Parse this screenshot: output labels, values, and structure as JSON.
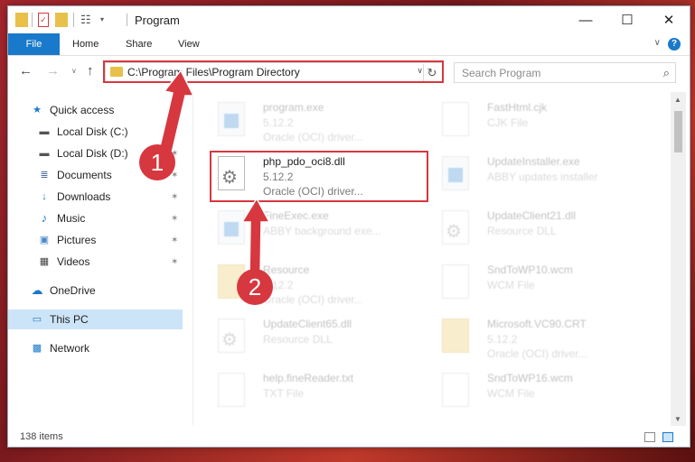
{
  "window": {
    "title": "Program"
  },
  "ribbon": {
    "tabs": [
      "File",
      "Home",
      "Share",
      "View"
    ],
    "help": "?"
  },
  "address": {
    "path": "C:\\Program Files\\Program Directory",
    "refresh_glyph": "↻",
    "dropdown_glyph": "∨"
  },
  "search": {
    "placeholder": "Search Program"
  },
  "nav_buttons": {
    "back": "←",
    "forward": "→",
    "up": "↑",
    "recent": "∨"
  },
  "window_controls": {
    "minimize": "—",
    "maximize": "☐",
    "close": "✕"
  },
  "sidebar": {
    "items": [
      {
        "label": "Quick access",
        "icon": "star-icon",
        "glyph": "★",
        "color": "#1979ca"
      },
      {
        "label": "Local Disk (C:)",
        "icon": "drive-icon",
        "glyph": "▬",
        "color": "#555555",
        "pinned": true
      },
      {
        "label": "Local Disk (D:)",
        "icon": "drive-icon",
        "glyph": "▬",
        "color": "#555555",
        "pinned": true
      },
      {
        "label": "Documents",
        "icon": "documents-icon",
        "glyph": "≣",
        "color": "#4a6fa5",
        "pinned": true
      },
      {
        "label": "Downloads",
        "icon": "download-icon",
        "glyph": "↓",
        "color": "#1979ca",
        "pinned": true
      },
      {
        "label": "Music",
        "icon": "music-icon",
        "glyph": "♪",
        "color": "#1979ca",
        "pinned": true
      },
      {
        "label": "Pictures",
        "icon": "pictures-icon",
        "glyph": "▣",
        "color": "#4a8ac9",
        "pinned": true
      },
      {
        "label": "Videos",
        "icon": "videos-icon",
        "glyph": "▦",
        "color": "#444444",
        "pinned": true
      },
      {
        "label": "OneDrive",
        "icon": "cloud-icon",
        "glyph": "☁",
        "color": "#1979ca"
      },
      {
        "label": "This PC",
        "icon": "computer-icon",
        "glyph": "▭",
        "color": "#1979ca",
        "selected": true
      },
      {
        "label": "Network",
        "icon": "network-icon",
        "glyph": "▩",
        "color": "#1979ca"
      }
    ],
    "pin_glyph": "✶"
  },
  "files": [
    {
      "name": "program.exe",
      "line2": "5.12.2",
      "line3": "Oracle (OCI) driver...",
      "kind": "exe"
    },
    {
      "name": "FastHtml.cjk",
      "line2": "CJK File",
      "line3": "",
      "kind": "doc"
    },
    {
      "name": "php_pdo_oci8.dll",
      "line2": "5.12.2",
      "line3": "Oracle (OCI) driver...",
      "kind": "gear",
      "highlighted": true
    },
    {
      "name": "UpdateInstaller.exe",
      "line2": "ABBY updates installer",
      "line3": "",
      "kind": "exe"
    },
    {
      "name": "FineExec.exe",
      "line2": "ABBY background exe...",
      "line3": "",
      "kind": "exe"
    },
    {
      "name": "UpdateClient21.dll",
      "line2": "Resource DLL",
      "line3": "",
      "kind": "gear"
    },
    {
      "name": "Resource",
      "line2": "5.12.2",
      "line3": "Oracle (OCI) driver...",
      "kind": "folder"
    },
    {
      "name": "SndToWP10.wcm",
      "line2": "WCM File",
      "line3": "",
      "kind": "doc"
    },
    {
      "name": "UpdateClient65.dll",
      "line2": "Resource DLL",
      "line3": "",
      "kind": "gear"
    },
    {
      "name": "Microsoft.VC90.CRT",
      "line2": "5.12.2",
      "line3": "Oracle (OCI) driver...",
      "kind": "folder"
    },
    {
      "name": "help.fineReader.txt",
      "line2": "TXT File",
      "line3": "",
      "kind": "doc"
    },
    {
      "name": "SndToWP16.wcm",
      "line2": "WCM File",
      "line3": "",
      "kind": "doc"
    }
  ],
  "status": {
    "items_count": "138 items"
  },
  "annotations": {
    "step1": "1",
    "step2": "2"
  },
  "colors": {
    "accent": "#1979ca",
    "annotation_red": "#d7373f",
    "selection": "#cce4f7"
  }
}
